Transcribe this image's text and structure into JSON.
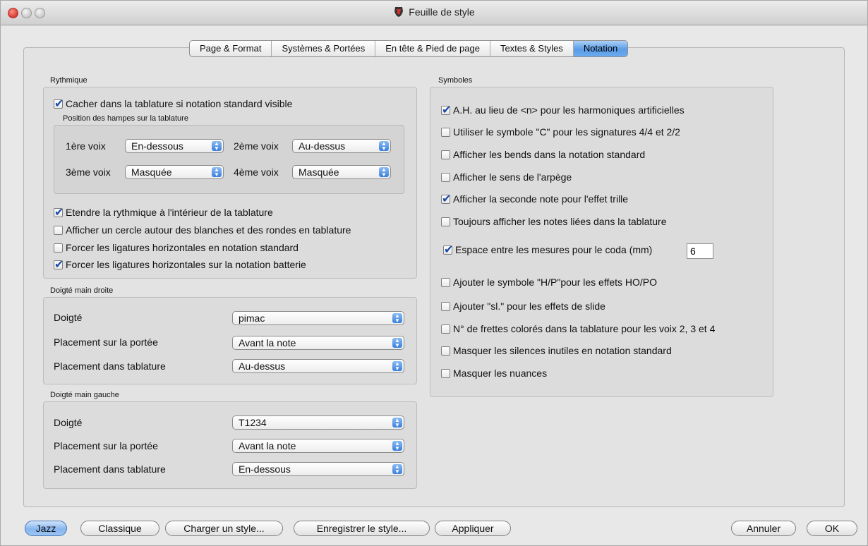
{
  "window": {
    "title": "Feuille de style"
  },
  "tabs": [
    {
      "label": "Page & Format"
    },
    {
      "label": "Systèmes & Portées"
    },
    {
      "label": "En tête & Pied de page"
    },
    {
      "label": "Textes & Styles"
    },
    {
      "label": "Notation",
      "active": true
    }
  ],
  "rythmique": {
    "title": "Rythmique",
    "hide_in_tab": {
      "label": "Cacher dans la tablature si notation standard visible",
      "checked": true
    },
    "stems_title": "Position des hampes sur la tablature",
    "voice1": {
      "label": "1ère voix",
      "value": "En-dessous"
    },
    "voice2": {
      "label": "2ème voix",
      "value": "Au-dessus"
    },
    "voice3": {
      "label": "3ème voix",
      "value": "Masquée"
    },
    "voice4": {
      "label": "4ème voix",
      "value": "Masquée"
    },
    "options": [
      {
        "label": "Etendre la rythmique à l'intérieur de la tablature",
        "checked": true
      },
      {
        "label": "Afficher un cercle autour des blanches et des rondes en tablature",
        "checked": false
      },
      {
        "label": "Forcer les ligatures horizontales en notation standard",
        "checked": false
      },
      {
        "label": "Forcer les ligatures horizontales sur la notation batterie",
        "checked": true
      }
    ]
  },
  "right_hand": {
    "title": "Doigté main droite",
    "fingering": {
      "label": "Doigté",
      "value": "pimac"
    },
    "staff_placement": {
      "label": "Placement sur la portée",
      "value": "Avant la note"
    },
    "tab_placement": {
      "label": "Placement dans tablature",
      "value": "Au-dessus"
    }
  },
  "left_hand": {
    "title": "Doigté main gauche",
    "fingering": {
      "label": "Doigté",
      "value": "T1234"
    },
    "staff_placement": {
      "label": "Placement sur la portée",
      "value": "Avant la note"
    },
    "tab_placement": {
      "label": "Placement dans tablature",
      "value": "En-dessous"
    }
  },
  "symboles": {
    "title": "Symboles",
    "options": [
      {
        "label": "A.H. au lieu de <n> pour les harmoniques artificielles",
        "checked": true
      },
      {
        "label": "Utiliser le symbole \"C\" pour les signatures 4/4 et 2/2",
        "checked": false
      },
      {
        "label": "Afficher les bends dans la notation standard",
        "checked": false
      },
      {
        "label": "Afficher le sens de l'arpège",
        "checked": false
      },
      {
        "label": "Afficher la seconde note pour l'effet trille",
        "checked": true
      },
      {
        "label": "Toujours afficher les notes liées dans la tablature",
        "checked": false
      },
      {
        "label": "Espace entre les mesures pour le coda (mm)",
        "checked": true,
        "value": "6"
      },
      {
        "label": "Ajouter le symbole \"H/P\"pour les effets HO/PO",
        "checked": false
      },
      {
        "label": "Ajouter \"sl.\" pour les effets de slide",
        "checked": false
      },
      {
        "label": "N° de frettes colorés dans la tablature pour les voix 2, 3 et 4",
        "checked": false
      },
      {
        "label": "Masquer les silences inutiles en notation standard",
        "checked": false
      },
      {
        "label": "Masquer les nuances",
        "checked": false
      }
    ]
  },
  "buttons": {
    "jazz": "Jazz",
    "classique": "Classique",
    "load": "Charger un style...",
    "save": "Enregistrer le style...",
    "apply": "Appliquer",
    "cancel": "Annuler",
    "ok": "OK"
  }
}
